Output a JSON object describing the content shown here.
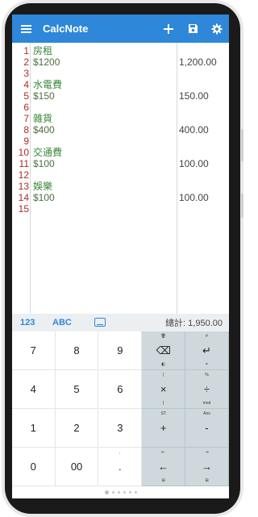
{
  "app": {
    "title": "CalcNote"
  },
  "toolbar": {
    "add_icon": "plus-icon",
    "save_icon": "save-icon",
    "settings_icon": "gear-icon",
    "menu_icon": "hamburger-menu-icon"
  },
  "editor": {
    "lines": [
      {
        "n": "1",
        "text": "房租",
        "result": ""
      },
      {
        "n": "2",
        "text": "$1200",
        "result": "1,200.00"
      },
      {
        "n": "3",
        "text": "",
        "result": ""
      },
      {
        "n": "4",
        "text": "水電費",
        "result": ""
      },
      {
        "n": "5",
        "text": "$150",
        "result": "150.00"
      },
      {
        "n": "6",
        "text": "",
        "result": ""
      },
      {
        "n": "7",
        "text": "雜貨",
        "result": ""
      },
      {
        "n": "8",
        "text": "$400",
        "result": "400.00"
      },
      {
        "n": "9",
        "text": "",
        "result": ""
      },
      {
        "n": "10",
        "text": "交通費",
        "result": ""
      },
      {
        "n": "11",
        "text": "$100",
        "result": "100.00"
      },
      {
        "n": "12",
        "text": "",
        "result": ""
      },
      {
        "n": "13",
        "text": "娛樂",
        "result": ""
      },
      {
        "n": "14",
        "text": "$100",
        "result": "100.00"
      },
      {
        "n": "15",
        "text": "",
        "result": ""
      }
    ]
  },
  "keyboard": {
    "tab_numeric": "123",
    "tab_alpha": "ABC",
    "total_text": "總計: 1,950.00",
    "keys": [
      {
        "label": "7",
        "top": "",
        "bottom": ""
      },
      {
        "label": "8",
        "top": "",
        "bottom": ""
      },
      {
        "label": "9",
        "top": "",
        "bottom": ""
      },
      {
        "label": "⌫",
        "top": "🗑",
        "bottom": "◧",
        "fn": true
      },
      {
        "label": "↵",
        "top": "#",
        "bottom": "=",
        "fn": true
      },
      {
        "label": "4",
        "top": "",
        "bottom": ""
      },
      {
        "label": "5",
        "top": "",
        "bottom": ""
      },
      {
        "label": "6",
        "top": "",
        "bottom": ""
      },
      {
        "label": "×",
        "top": "(",
        "bottom": ")",
        "fn": true
      },
      {
        "label": "÷",
        "top": "%",
        "bottom": "mod",
        "fn": true
      },
      {
        "label": "1",
        "top": "",
        "bottom": ""
      },
      {
        "label": "2",
        "top": "",
        "bottom": ""
      },
      {
        "label": "3",
        "top": "",
        "bottom": ""
      },
      {
        "label": "+",
        "top": "ST",
        "bottom": "",
        "fn": true
      },
      {
        "label": "-",
        "top": "Ans",
        "bottom": "",
        "fn": true
      },
      {
        "label": "0",
        "top": "",
        "bottom": ""
      },
      {
        "label": "00",
        "top": "",
        "bottom": ""
      },
      {
        "label": ".",
        "top": ",",
        "bottom": ""
      },
      {
        "label": "←",
        "top": "⇤",
        "bottom": "⊞",
        "fn": true
      },
      {
        "label": "→",
        "top": "⇥",
        "bottom": "⊞",
        "fn": true
      }
    ]
  },
  "pager": {
    "pages": 6,
    "active": 0
  }
}
